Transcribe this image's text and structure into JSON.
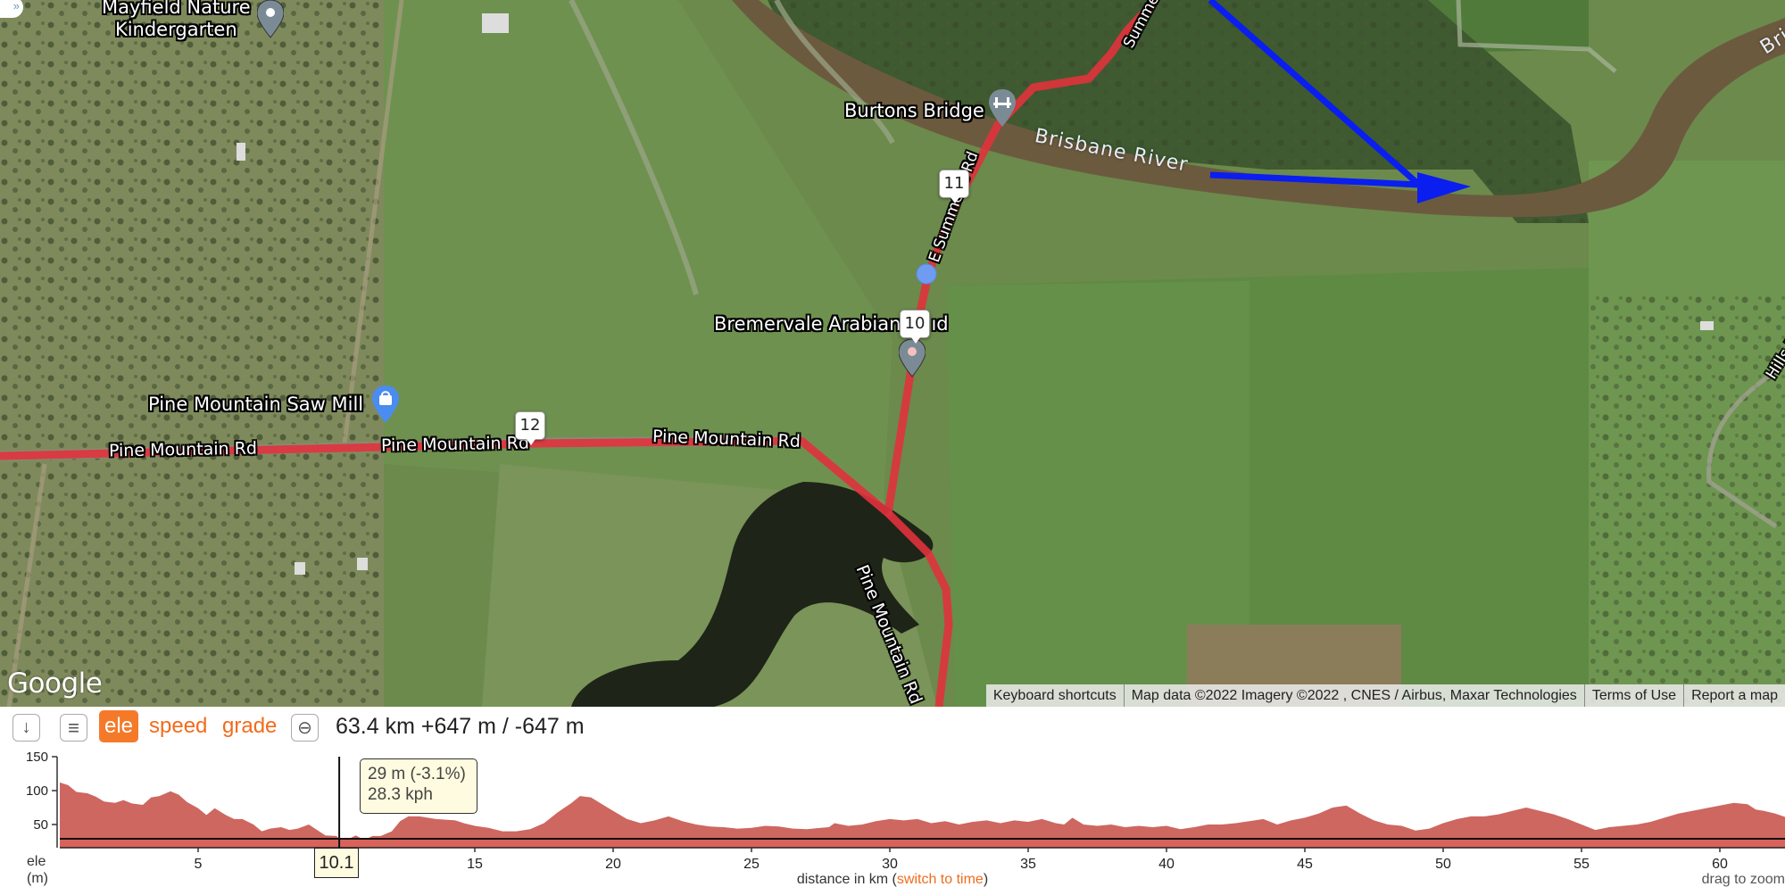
{
  "map": {
    "pois": [
      {
        "name": "Mayfield Nature Kindergarten",
        "line1": "Mayfield Nature",
        "line2": "Kindergarten",
        "icon": "map-pin-icon"
      },
      {
        "name": "Burtons Bridge",
        "icon": "bridge-icon"
      },
      {
        "name": "Bremervale Arabian Stud",
        "visible_text": "Bremervale Arabian",
        "visible_tail": "ıd",
        "icon": "map-pin-icon"
      },
      {
        "name": "Pine Mountain Saw Mill",
        "icon": "shopping-bag-icon"
      }
    ],
    "roads": [
      {
        "label": "Pine Mountain Rd"
      },
      {
        "label": "Pine Mountain Rd"
      },
      {
        "label": "Pine Mountain Rd"
      },
      {
        "label": "Pine Mountain Rd"
      },
      {
        "label": "E Summerville Rd",
        "visible_text": "E Summer  s Rd"
      },
      {
        "label": "Summerville",
        "visible_text": "Summer"
      },
      {
        "label": "Hills Rd",
        "visible_text": "Hills R"
      }
    ],
    "river": {
      "label": "Brisbane River",
      "partial_label": "Bris"
    },
    "waypoints": [
      "10",
      "11",
      "12"
    ],
    "route_color": "#e0323c",
    "arrow_color": "#0a1ef0",
    "position_marker_color": "#6f9cf0",
    "google_logo": "Google",
    "attribution": [
      "Keyboard shortcuts",
      "Map data ©2022 Imagery ©2022 , CNES / Airbus, Maxar Technologies",
      "Terms of Use",
      "Report a map error"
    ],
    "attribution_visible_last": "Report a map",
    "sidebar_toggle_icon": "»"
  },
  "toolbar": {
    "download_icon": "↓",
    "menu_icon": "≡",
    "tabs": [
      {
        "label": "ele",
        "active": true
      },
      {
        "label": "speed",
        "active": false
      },
      {
        "label": "grade",
        "active": false
      }
    ],
    "zoom_out_icon": "⊖",
    "stats": "63.4 km +647 m / -647 m",
    "accent_color": "#f47a2a"
  },
  "chart_data": {
    "type": "area",
    "title": "",
    "xlabel": "distance in km",
    "xlabel_link": "switch to time",
    "ylabel": "ele",
    "ylabel_unit": "(m)",
    "xlim": [
      0,
      63.4
    ],
    "ylim": [
      15,
      150
    ],
    "yticks": [
      50,
      100,
      150
    ],
    "xticks": [
      5,
      10,
      15,
      20,
      25,
      30,
      35,
      40,
      45,
      50,
      55,
      60
    ],
    "x": [
      0,
      0.3,
      0.6,
      1,
      1.3,
      1.6,
      2,
      2.3,
      2.6,
      3,
      3.3,
      3.6,
      4,
      4.3,
      4.6,
      5,
      5.3,
      5.6,
      6,
      6.3,
      6.6,
      7,
      7.3,
      7.6,
      8,
      8.3,
      8.6,
      9,
      9.3,
      9.6,
      10,
      10.1,
      10.4,
      10.7,
      11,
      11.3,
      11.6,
      12,
      12.3,
      12.6,
      13,
      13.3,
      13.6,
      14,
      14.3,
      14.6,
      15,
      15.5,
      16,
      16.5,
      17,
      17.5,
      18,
      18.5,
      18.8,
      19.2,
      19.6,
      20,
      20.5,
      21,
      21.5,
      22,
      22.5,
      23,
      23.5,
      24,
      24.5,
      25,
      25.5,
      26,
      26.5,
      27,
      27.5,
      27.8,
      28,
      28.5,
      29,
      29.5,
      30,
      30.5,
      31,
      31.5,
      32,
      32.5,
      33,
      33.5,
      34,
      34.5,
      35,
      35.5,
      36,
      36.3,
      36.6,
      37,
      37.5,
      38,
      38.5,
      39,
      39.5,
      40,
      40.5,
      41,
      41.5,
      42,
      42.5,
      43,
      43.5,
      44,
      44.5,
      45,
      45.5,
      46,
      46.5,
      47,
      47.5,
      48,
      48.5,
      49,
      49.5,
      50,
      50.5,
      51,
      51.5,
      52,
      52.5,
      53,
      53.5,
      54,
      54.5,
      55,
      55.5,
      56,
      56.5,
      57,
      57.5,
      58,
      58.5,
      59,
      59.5,
      60,
      60.5,
      61,
      61.3,
      61.6,
      62,
      62.3,
      62.6,
      63,
      63.4
    ],
    "series": [
      {
        "name": "elevation (m)",
        "values": [
          112,
          108,
          98,
          96,
          91,
          84,
          82,
          86,
          81,
          79,
          90,
          92,
          99,
          94,
          83,
          74,
          64,
          74,
          64,
          58,
          58,
          50,
          40,
          44,
          46,
          42,
          44,
          50,
          42,
          34,
          33,
          29,
          28,
          34,
          27,
          33,
          33,
          40,
          55,
          62,
          62,
          60,
          58,
          57,
          56,
          52,
          48,
          45,
          40,
          40,
          43,
          52,
          68,
          82,
          92,
          90,
          80,
          70,
          58,
          52,
          56,
          62,
          55,
          50,
          47,
          46,
          44,
          45,
          48,
          47,
          44,
          43,
          45,
          46,
          52,
          48,
          50,
          55,
          58,
          56,
          58,
          52,
          55,
          50,
          54,
          56,
          52,
          56,
          54,
          58,
          52,
          50,
          60,
          50,
          48,
          50,
          46,
          48,
          46,
          48,
          43,
          46,
          50,
          50,
          52,
          55,
          58,
          50,
          56,
          60,
          66,
          75,
          78,
          66,
          56,
          50,
          48,
          41,
          44,
          52,
          58,
          62,
          62,
          65,
          70,
          75,
          70,
          65,
          58,
          50,
          42,
          46,
          48,
          50,
          54,
          60,
          66,
          70,
          74,
          78,
          82,
          80,
          72,
          70,
          66,
          62,
          58,
          48,
          60,
          66,
          56,
          60,
          64,
          66
        ]
      },
      {
        "name": "cursor",
        "x": 10.1,
        "y": 29
      }
    ],
    "cursor": {
      "x_label": "10.1",
      "elevation": "29 m (-3.1%)",
      "speed": "28.3 kph"
    },
    "fill_color": "#cd6760",
    "legend": "none",
    "grid": false,
    "hint": "drag to zoom"
  }
}
